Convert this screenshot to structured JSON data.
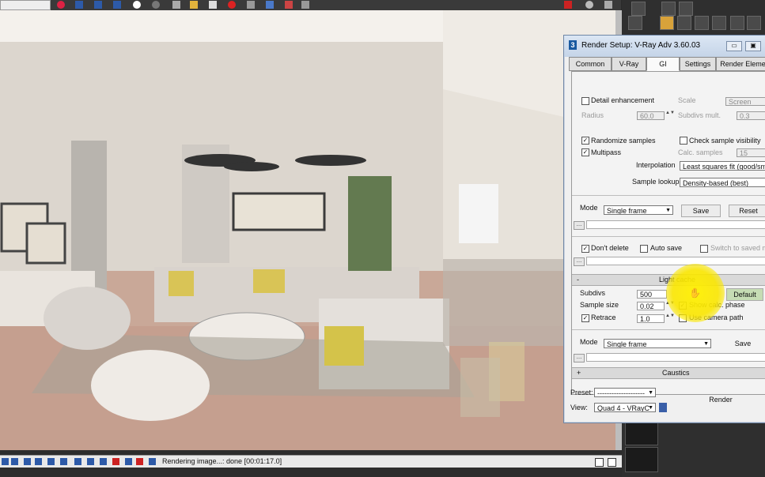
{
  "status": {
    "text": "Rendering image...: done [00:01:17.0]"
  },
  "dialog": {
    "title": "Render Setup: V-Ray Adv 3.60.03",
    "tabs": [
      {
        "label": "Common"
      },
      {
        "label": "V-Ray"
      },
      {
        "label": "GI",
        "active": true
      },
      {
        "label": "Settings"
      },
      {
        "label": "Render Eleme"
      }
    ],
    "detail": {
      "label": "Detail enhancement",
      "scale_label": "Scale",
      "scale_value": "Screen",
      "radius_label": "Radius",
      "radius_value": "60.0",
      "subdivs_mult_label": "Subdivs mult.",
      "subdivs_mult_value": "0.3"
    },
    "irradiance": {
      "randomize_label": "Randomize samples",
      "check_visibility_label": "Check sample visibility",
      "multipass_label": "Multipass",
      "calc_samples_label": "Calc. samples",
      "calc_samples_value": "15",
      "interpolation_label": "Interpolation",
      "interpolation_value": "Least squares fit (good/sm",
      "sample_lookup_label": "Sample lookup",
      "sample_lookup_value": "Density-based (best)",
      "mode_label": "Mode",
      "mode_value": "Single frame",
      "save_label": "Save",
      "reset_label": "Reset",
      "dont_delete_label": "Don't delete",
      "auto_save_label": "Auto save",
      "switch_saved_label": "Switch to saved m"
    },
    "light_cache": {
      "header": "Light cache",
      "subdivs_label": "Subdivs",
      "subdivs_value": "500",
      "default_label": "Default",
      "sample_size_label": "Sample size",
      "sample_size_value": "0.02",
      "show_calc_label": "Show calc. phase",
      "retrace_label": "Retrace",
      "retrace_value": "1.0",
      "camera_path_label": "Use camera path",
      "mode_label": "Mode",
      "mode_value": "Single frame",
      "save_label": "Save"
    },
    "caustics": {
      "label": "Caustics"
    },
    "footer": {
      "preset_label": "Preset:",
      "preset_value": "--------------------",
      "view_label": "View:",
      "view_value": "Quad 4 - VRayC",
      "render_label": "Render"
    }
  }
}
